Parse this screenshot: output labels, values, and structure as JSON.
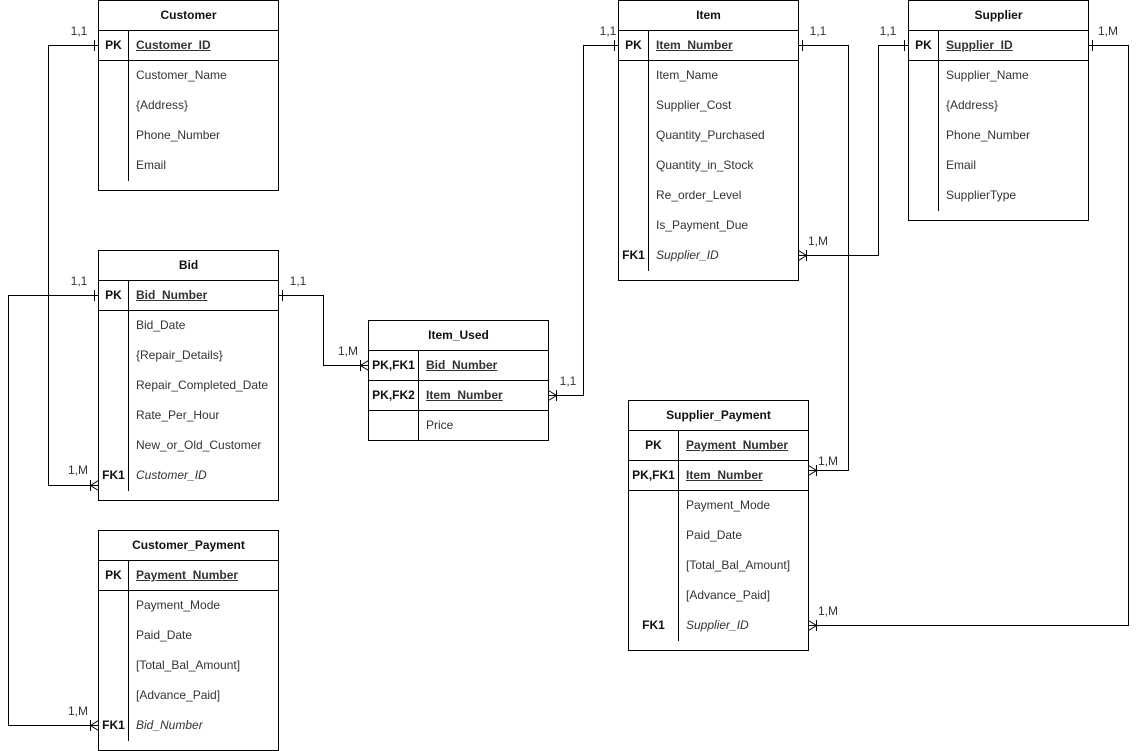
{
  "entities": {
    "customer": {
      "title": "Customer",
      "key_rows": [
        {
          "key": "PK",
          "attr": "Customer_ID"
        }
      ],
      "attributes": [
        {
          "key": "",
          "name": "Customer_Name"
        },
        {
          "key": "",
          "name": "{Address}"
        },
        {
          "key": "",
          "name": "Phone_Number"
        },
        {
          "key": "",
          "name": "Email"
        }
      ]
    },
    "bid": {
      "title": "Bid",
      "key_rows": [
        {
          "key": "PK",
          "attr": "Bid_Number"
        }
      ],
      "attributes": [
        {
          "key": "",
          "name": "Bid_Date"
        },
        {
          "key": "",
          "name": "{Repair_Details}"
        },
        {
          "key": "",
          "name": "Repair_Completed_Date"
        },
        {
          "key": "",
          "name": "Rate_Per_Hour"
        },
        {
          "key": "",
          "name": "New_or_Old_Customer"
        },
        {
          "key": "FK1",
          "name": "Customer_ID"
        }
      ]
    },
    "customer_payment": {
      "title": "Customer_Payment",
      "key_rows": [
        {
          "key": "PK",
          "attr": "Payment_Number"
        }
      ],
      "attributes": [
        {
          "key": "",
          "name": "Payment_Mode"
        },
        {
          "key": "",
          "name": "Paid_Date"
        },
        {
          "key": "",
          "name": "[Total_Bal_Amount]"
        },
        {
          "key": "",
          "name": "[Advance_Paid]"
        },
        {
          "key": "FK1",
          "name": "Bid_Number"
        }
      ]
    },
    "item_used": {
      "title": "Item_Used",
      "key_rows": [
        {
          "key": "PK,FK1",
          "attr": "Bid_Number"
        },
        {
          "key": "PK,FK2",
          "attr": "Item_Number"
        }
      ],
      "attributes": [
        {
          "key": "",
          "name": "Price"
        }
      ]
    },
    "item": {
      "title": "Item",
      "key_rows": [
        {
          "key": "PK",
          "attr": "Item_Number"
        }
      ],
      "attributes": [
        {
          "key": "",
          "name": "Item_Name"
        },
        {
          "key": "",
          "name": "Supplier_Cost"
        },
        {
          "key": "",
          "name": "Quantity_Purchased"
        },
        {
          "key": "",
          "name": "Quantity_in_Stock"
        },
        {
          "key": "",
          "name": "Re_order_Level"
        },
        {
          "key": "",
          "name": "Is_Payment_Due"
        },
        {
          "key": "FK1",
          "name": "Supplier_ID"
        }
      ]
    },
    "supplier": {
      "title": "Supplier",
      "key_rows": [
        {
          "key": "PK",
          "attr": "Supplier_ID"
        }
      ],
      "attributes": [
        {
          "key": "",
          "name": "Supplier_Name"
        },
        {
          "key": "",
          "name": "{Address}"
        },
        {
          "key": "",
          "name": "Phone_Number"
        },
        {
          "key": "",
          "name": "Email"
        },
        {
          "key": "",
          "name": "SupplierType"
        }
      ]
    },
    "supplier_payment": {
      "title": "Supplier_Payment",
      "key_rows": [
        {
          "key": "PK",
          "attr": "Payment_Number"
        },
        {
          "key": "PK,FK1",
          "attr": "Item_Number"
        }
      ],
      "attributes": [
        {
          "key": "",
          "name": "Payment_Mode"
        },
        {
          "key": "",
          "name": "Paid_Date"
        },
        {
          "key": "",
          "name": "[Total_Bal_Amount]"
        },
        {
          "key": "",
          "name": "[Advance_Paid]"
        },
        {
          "key": "FK1",
          "name": "Supplier_ID"
        }
      ]
    }
  },
  "relationships": [
    {
      "from": "Customer",
      "to": "Bid",
      "from_cardinality": "1,1",
      "to_cardinality": "1,M"
    },
    {
      "from": "Bid",
      "to": "Customer_Payment",
      "from_cardinality": "1,1",
      "to_cardinality": "1,M"
    },
    {
      "from": "Bid",
      "to": "Item_Used",
      "from_cardinality": "1,1",
      "to_cardinality": "1,M"
    },
    {
      "from": "Item",
      "to": "Item_Used",
      "from_cardinality": "1,1",
      "to_cardinality": "1,1"
    },
    {
      "from": "Supplier",
      "to": "Item",
      "from_cardinality": "1,1",
      "to_cardinality": "1,M"
    },
    {
      "from": "Item",
      "to": "Supplier_Payment",
      "from_cardinality": "1,1",
      "to_cardinality": "1,M"
    },
    {
      "from": "Supplier",
      "to": "Supplier_Payment",
      "from_cardinality": "1,M",
      "to_cardinality": "1,M"
    }
  ]
}
